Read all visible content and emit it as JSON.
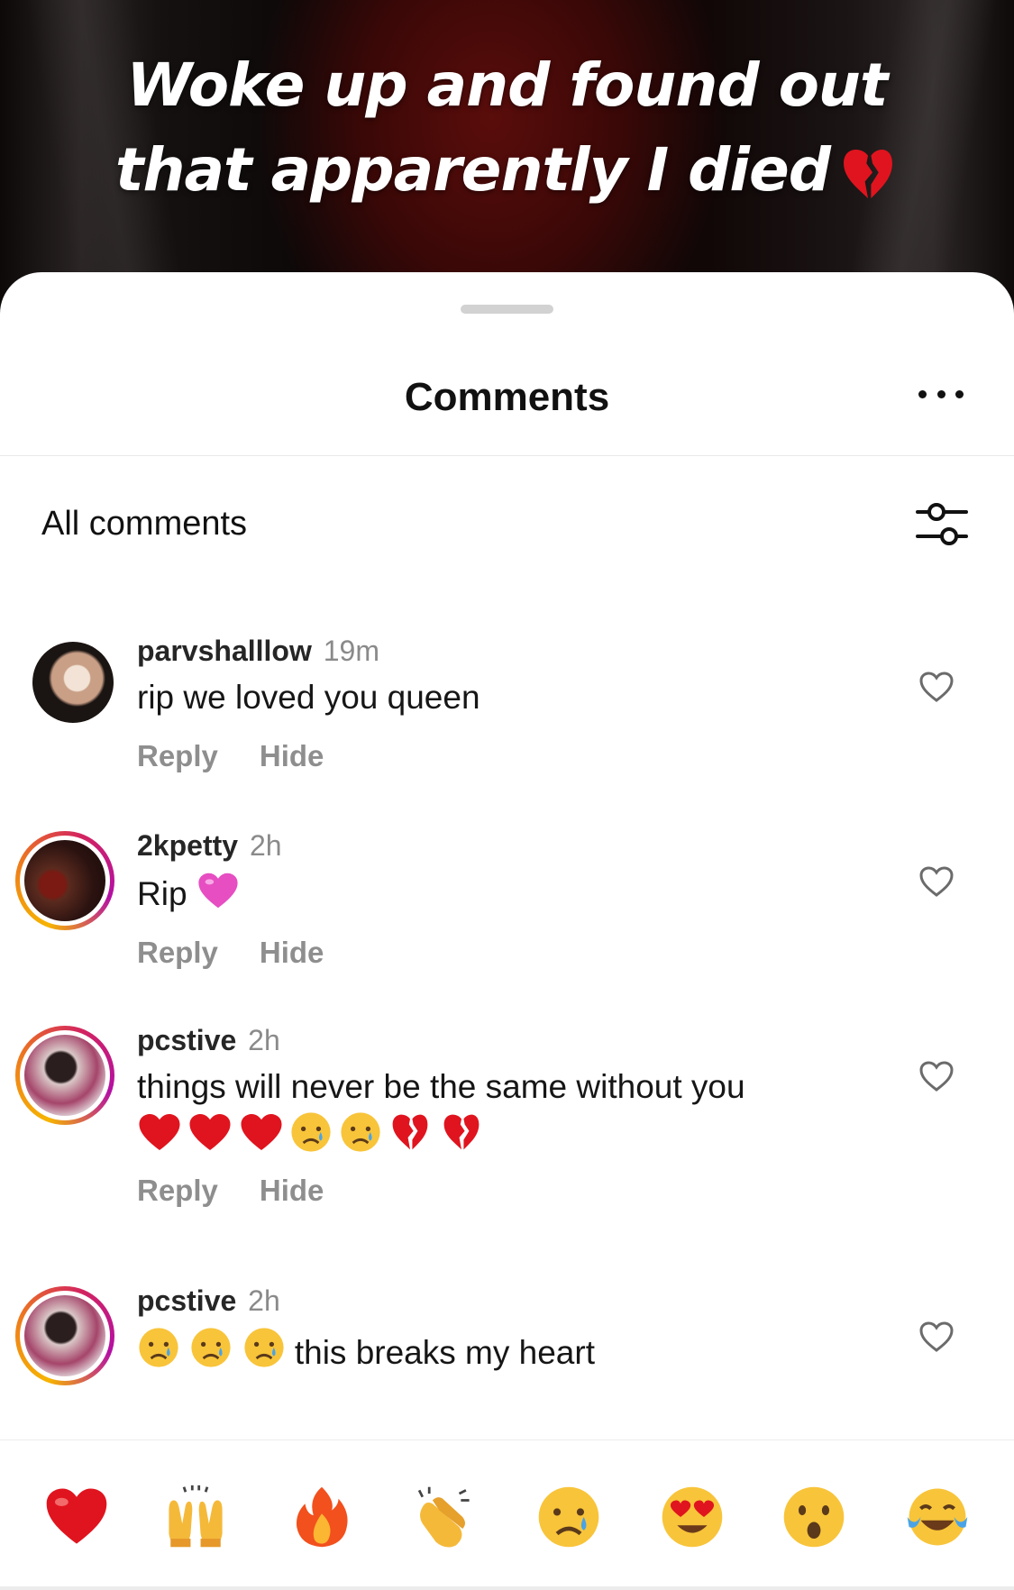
{
  "video": {
    "caption_line1": "Woke up and found out",
    "caption_line2": "that apparently I died",
    "caption_emoji": "broken-heart-icon"
  },
  "sheet": {
    "title": "Comments",
    "more_icon": "more-horizontal-icon",
    "filter_label": "All comments",
    "filter_icon": "sliders-icon"
  },
  "comments": [
    {
      "username": "parvshalllow",
      "time": "19m",
      "text": "rip we loved you queen",
      "emoji_after": [],
      "emoji_before": [],
      "emoji_line": [],
      "reply_label": "Reply",
      "hide_label": "Hide",
      "story_ring": false
    },
    {
      "username": "2kpetty",
      "time": "2h",
      "text": "Rip",
      "emoji_after": [
        "pink-heart"
      ],
      "emoji_before": [],
      "emoji_line": [],
      "reply_label": "Reply",
      "hide_label": "Hide",
      "story_ring": true
    },
    {
      "username": "pcstive",
      "time": "2h",
      "text": "things will never be the same without you",
      "emoji_after": [],
      "emoji_before": [],
      "emoji_line": [
        "red-heart",
        "red-heart",
        "red-heart",
        "crying-face",
        "crying-face",
        "broken-heart",
        "broken-heart"
      ],
      "reply_label": "Reply",
      "hide_label": "Hide",
      "story_ring": true
    },
    {
      "username": "pcstive",
      "time": "2h",
      "text": "this breaks my heart",
      "emoji_after": [],
      "emoji_before": [
        "crying-face",
        "crying-face",
        "crying-face"
      ],
      "emoji_line": [],
      "reply_label": "Reply",
      "hide_label": "Hide",
      "story_ring": true
    }
  ],
  "reactions": [
    "red-heart",
    "raising-hands",
    "fire",
    "clapping-hands",
    "crying-face",
    "heart-eyes-face",
    "surprised-face",
    "tears-of-joy-face"
  ],
  "colors": {
    "accent_red": "#e0141e",
    "secondary_text": "#8e8e8e",
    "story_ring_start": "#f6b400",
    "story_ring_end": "#b40fa5"
  }
}
